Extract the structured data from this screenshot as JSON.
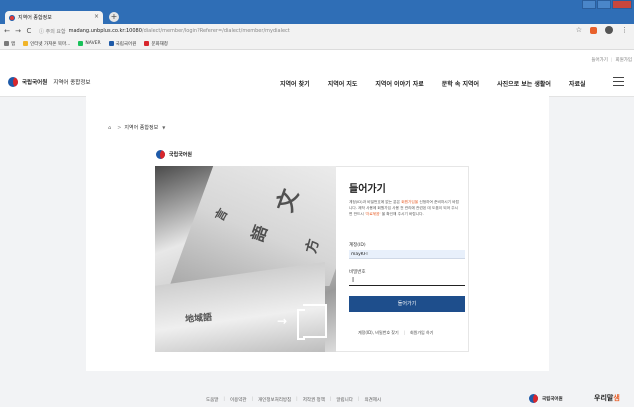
{
  "browser": {
    "tab_title": "지역어 종합정보",
    "tab_close": "×",
    "new_tab": "+",
    "back": "←",
    "forward": "→",
    "reload": "C",
    "security_warning": "ⓘ 주의 요함",
    "url_host": "madang.unbplus.co.kr:10080",
    "url_path": "/dialect/member/login?Referer=/dialect/member/mydialect",
    "bookmarks": [
      {
        "label": "앱",
        "color": "#7a7a7a"
      },
      {
        "label": "인터넷 가져온 북마...",
        "color": "#f0b429"
      },
      {
        "label": "NAVER",
        "color": "#19c15a"
      },
      {
        "label": "국립국어원",
        "color": "#1e5aa8"
      },
      {
        "label": "문화재청",
        "color": "#d8262c"
      }
    ]
  },
  "site": {
    "utility": {
      "my": "들어가기",
      "join": "회원가입"
    },
    "logo_name": "국립국어원",
    "logo_sub": "지역어 종합정보",
    "nav": [
      "지역어 찾기",
      "지역어 지도",
      "지역어 이야기 자료",
      "문학 속 지역어",
      "사진으로 보는 생활어",
      "자료실"
    ]
  },
  "breadcrumb": {
    "home_icon": "⌂",
    "separator": ">",
    "current": "지역어 종합정보",
    "caret": "▼"
  },
  "login": {
    "inner_logo": "국립국어원",
    "title": "들어가기",
    "desc_part1": "계정(ID)과 비밀번호에 없는 분은 ",
    "desc_highlight1": "회원가입을 ",
    "desc_part2": "신청하여 \n준비하시기 바랍니다. 제작 사용에 회원가입 사용 전 관리에 관련된 \n데 도움이 되어 주시면 반드시 ",
    "desc_highlight2": "'자료묶음'",
    "desc_part3": " 을 확인해 주시기 바랍니다.",
    "id_label": "계정(ID)",
    "id_value": "mayKFl",
    "pw_label": "비밀번호",
    "button": "들어가기",
    "find_link": "계정(ID), 비밀번호 찾기",
    "join_link": "회원가입 하기"
  },
  "footer": {
    "links": [
      "도움말",
      "이용약관",
      "개인정보처리방침",
      "저작권 정책",
      "알립니다",
      "의견제시"
    ],
    "logo": "국립국어원",
    "brand_main": "우리말",
    "brand_accent": "샘"
  },
  "colors": {
    "primary": "#1e4e8c",
    "accent": "#e8612c",
    "logo_blue": "#1e5aa8",
    "logo_red": "#d8262c"
  }
}
